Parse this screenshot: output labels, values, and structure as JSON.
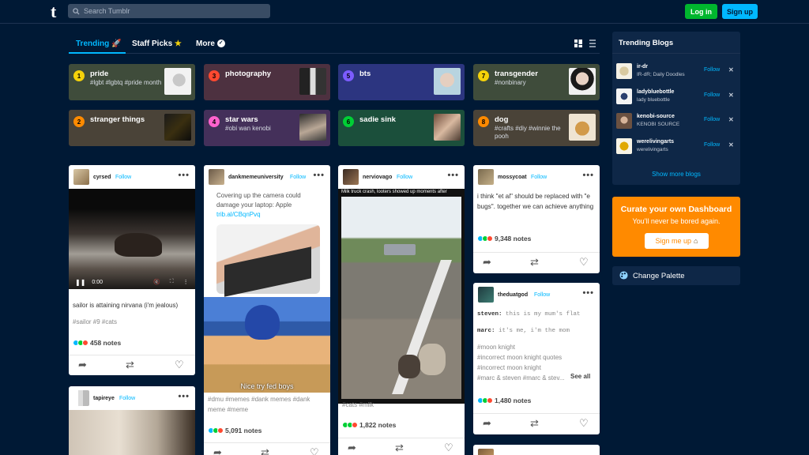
{
  "header": {
    "search_placeholder": "Search Tumblr",
    "login_label": "Log in",
    "signup_label": "Sign up",
    "logo_letter": "t"
  },
  "tabs": {
    "trending": "Trending",
    "staff_picks": "Staff Picks",
    "more": "More"
  },
  "trending": [
    {
      "num": "1",
      "name": "pride",
      "tags": "#lgbt #lgbtq #pride month",
      "num_color": "#f5d20a",
      "bg": "#3f4c3b"
    },
    {
      "num": "2",
      "name": "stranger things",
      "tags": "",
      "num_color": "#ff8a00",
      "bg": "#4a4338"
    },
    {
      "num": "3",
      "name": "photography",
      "tags": "",
      "num_color": "#ff4930",
      "bg": "#4d3140"
    },
    {
      "num": "4",
      "name": "star wars",
      "tags": "#obi wan kenobi",
      "num_color": "#ff62ce",
      "bg": "#44305a"
    },
    {
      "num": "5",
      "name": "bts",
      "tags": "",
      "num_color": "#7c5cff",
      "bg": "#2c3580"
    },
    {
      "num": "6",
      "name": "sadie sink",
      "tags": "",
      "num_color": "#00cf35",
      "bg": "#1b4f3b"
    },
    {
      "num": "7",
      "name": "transgender",
      "tags": "#nonbinary",
      "num_color": "#f5d20a",
      "bg": "#3f4c3b"
    },
    {
      "num": "8",
      "name": "dog",
      "tags": "#crafts #diy #winnie the pooh",
      "num_color": "#ff8a00",
      "bg": "#4a4338"
    }
  ],
  "posts": {
    "p1": {
      "user": "cyrsed",
      "follow": "Follow",
      "time": "0:00",
      "text": "sailor is attaining nirvana (i'm jealous)",
      "tags": "#sailor   #9   #cats",
      "notes": "458 notes"
    },
    "p2": {
      "user": "dankmemeuniversity",
      "follow": "Follow",
      "text": "Covering up the camera could damage your laptop: Apple ",
      "link": "trib.al/CBqnPvq",
      "caption": "Nice try fed boys",
      "tags": "#dmu   #memes   #dank memes   #dank meme   #meme",
      "notes": "5,091 notes"
    },
    "p3": {
      "user": "nerviovago",
      "follow": "Follow",
      "headline": "Milk truck crash, looters showed up moments after",
      "tags": "#cats   #milk",
      "notes": "1,822 notes"
    },
    "p4": {
      "user": "mossycoat",
      "follow": "Follow",
      "text": "i think \"et al\" should be replaced with \"e bugs\". together we can achieve anything",
      "notes": "9,348 notes"
    },
    "p5": {
      "user": "theduatgod",
      "follow": "Follow",
      "line1_speaker": "steven:",
      "line1_text": " this is my mum's flat",
      "line2_speaker": "marc:",
      "line2_text": " it's me, i'm the mom",
      "tags": "#moon knight\n#incorrect moon knight quotes\n#incorrect moon knight\n#marc & steven   #marc & stev...",
      "see_all": "See all",
      "notes": "1,480 notes"
    },
    "p6": {
      "user": "tapireye",
      "follow": "Follow"
    }
  },
  "sidebar": {
    "title": "Trending Blogs",
    "blogs": [
      {
        "name": "ir-dr",
        "sub": "IR-dR; Daily Doodles",
        "follow": "Follow"
      },
      {
        "name": "ladybluebottle",
        "sub": "lady bluebottle",
        "follow": "Follow"
      },
      {
        "name": "kenobi-source",
        "sub": "KENOBI SOURCE",
        "follow": "Follow"
      },
      {
        "name": "werelivingarts",
        "sub": "werelivingarts",
        "follow": "Follow"
      }
    ],
    "show_more": "Show more blogs"
  },
  "curate": {
    "title": "Curate your own Dashboard",
    "subtitle": "You'll never be bored again.",
    "button": "Sign me up"
  },
  "palette": {
    "label": "Change Palette"
  },
  "colors": {
    "bg": "#001935",
    "accent": "#00b8ff",
    "green": "#00b62e",
    "orange": "#ff8a00"
  }
}
